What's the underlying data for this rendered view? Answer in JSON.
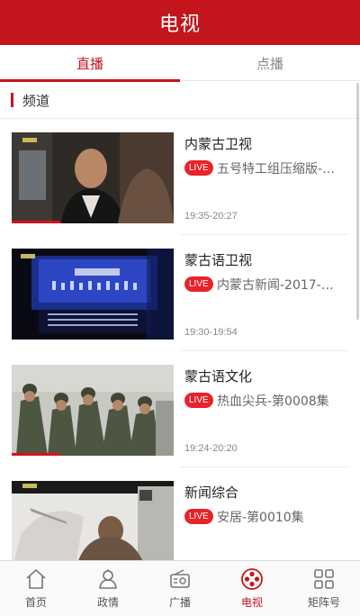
{
  "header": {
    "title": "电视"
  },
  "tabs": [
    {
      "label": "直播",
      "active": true
    },
    {
      "label": "点播",
      "active": false
    }
  ],
  "section": {
    "title": "频道"
  },
  "channels": [
    {
      "name": "内蒙古卫视",
      "badge": "LIVE",
      "program": "五号特工组压缩版-…",
      "time": "19:35-20:27"
    },
    {
      "name": "蒙古语卫视",
      "badge": "LIVE",
      "program": "内蒙古新闻-2017-…",
      "time": "19:30-19:54"
    },
    {
      "name": "蒙古语文化",
      "badge": "LIVE",
      "program": "热血尖兵-第0008集",
      "time": "19:24-20:20"
    },
    {
      "name": "新闻综合",
      "badge": "LIVE",
      "program": "安居-第0010集",
      "time": ""
    }
  ],
  "nav": [
    {
      "label": "首页",
      "icon": "home-icon",
      "active": false
    },
    {
      "label": "政情",
      "icon": "person-icon",
      "active": false
    },
    {
      "label": "广播",
      "icon": "radio-icon",
      "active": false
    },
    {
      "label": "电视",
      "icon": "film-reel-icon",
      "active": true
    },
    {
      "label": "矩阵号",
      "icon": "grid-icon",
      "active": false
    }
  ],
  "colors": {
    "brand_red": "#c4151c",
    "live_badge": "#e8232a"
  }
}
